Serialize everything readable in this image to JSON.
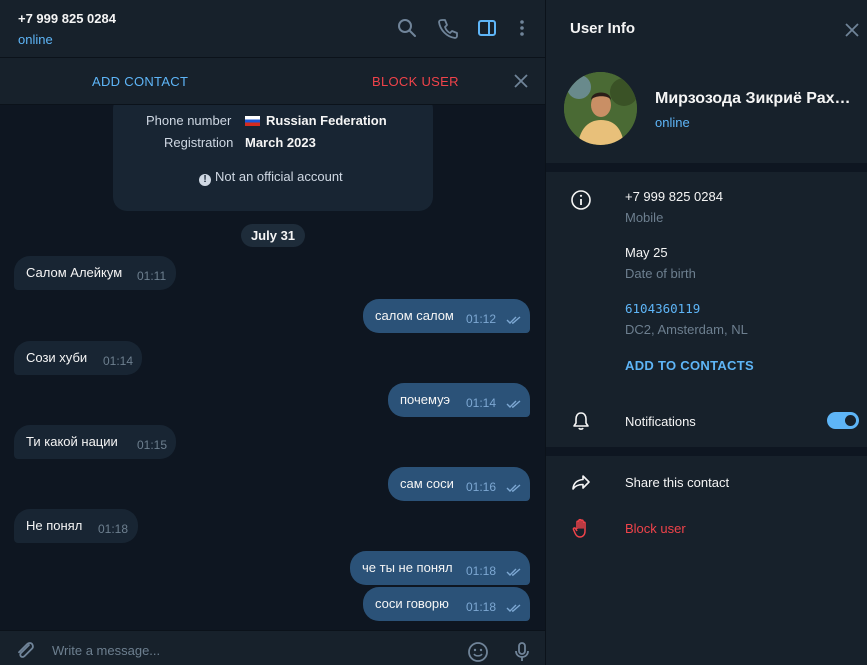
{
  "header": {
    "phone": "+7 999 825 0284",
    "status": "online"
  },
  "action_bar": {
    "add_contact": "ADD CONTACT",
    "block_user": "BLOCK USER"
  },
  "info_card": {
    "phone_label": "Phone number",
    "phone_value": "Russian Federation",
    "registration_label": "Registration",
    "registration_value": "March 2023",
    "note": "Not an official account"
  },
  "date_separator": "July 31",
  "messages": [
    {
      "dir": "in",
      "text": "Салом Алейкум",
      "time": "01:11"
    },
    {
      "dir": "out",
      "text": "салом салом",
      "time": "01:12"
    },
    {
      "dir": "in",
      "text": "Сози хуби",
      "time": "01:14"
    },
    {
      "dir": "out",
      "text": "почемуэ",
      "time": "01:14"
    },
    {
      "dir": "in",
      "text": "Ти какой нации",
      "time": "01:15"
    },
    {
      "dir": "out",
      "text": "сам соси",
      "time": "01:16"
    },
    {
      "dir": "in",
      "text": "Не понял",
      "time": "01:18"
    },
    {
      "dir": "out",
      "text": "че ты не понял",
      "time": "01:18"
    },
    {
      "dir": "out",
      "text": "соси говорю",
      "time": "01:18"
    }
  ],
  "composer": {
    "placeholder": "Write a message..."
  },
  "user_info": {
    "title": "User Info",
    "name": "Мирзозода Зикриё Рахимов",
    "status": "online",
    "phone": "+7 999 825 0284",
    "phone_label": "Mobile",
    "birthday": "May 25",
    "birthday_label": "Date of birth",
    "user_id": "6104360119",
    "datacenter": "DC2, Amsterdam, NL",
    "add_to_contacts": "ADD TO CONTACTS",
    "notifications": "Notifications",
    "notifications_on": true,
    "share": "Share this contact",
    "block": "Block user"
  },
  "colors": {
    "accent": "#5eb5f7",
    "danger": "#f0434a",
    "outgoing_bubble": "#2b5278",
    "incoming_bubble": "#182533"
  }
}
